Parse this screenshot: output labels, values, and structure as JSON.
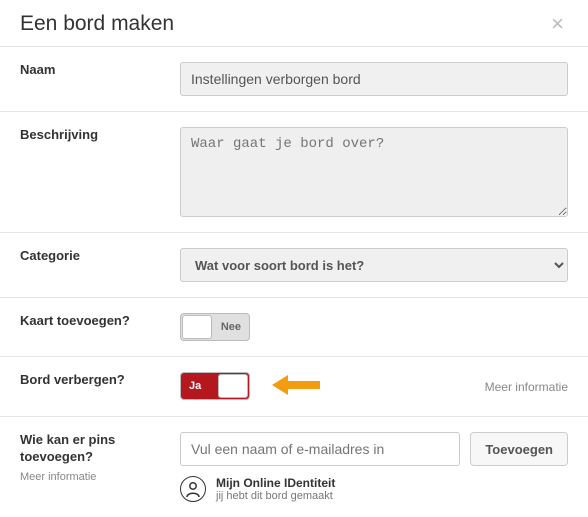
{
  "modal": {
    "title": "Een bord maken"
  },
  "fields": {
    "name": {
      "label": "Naam",
      "value": "Instellingen verborgen bord"
    },
    "description": {
      "label": "Beschrijving",
      "placeholder": "Waar gaat je bord over?"
    },
    "category": {
      "label": "Categorie",
      "selected": "Wat voor soort bord is het?"
    },
    "addMap": {
      "label": "Kaart toevoegen?",
      "value": "Nee"
    },
    "hideBoard": {
      "label": "Bord verbergen?",
      "value": "Ja",
      "moreInfo": "Meer informatie"
    },
    "collaborators": {
      "label": "Wie kan er pins toevoegen?",
      "moreInfo": "Meer informatie",
      "placeholder": "Vul een naam of e-mailadres in",
      "addButton": "Toevoegen",
      "creator": {
        "name": "Mijn Online IDentiteit",
        "sub": "jij hebt dit bord gemaakt"
      }
    }
  }
}
